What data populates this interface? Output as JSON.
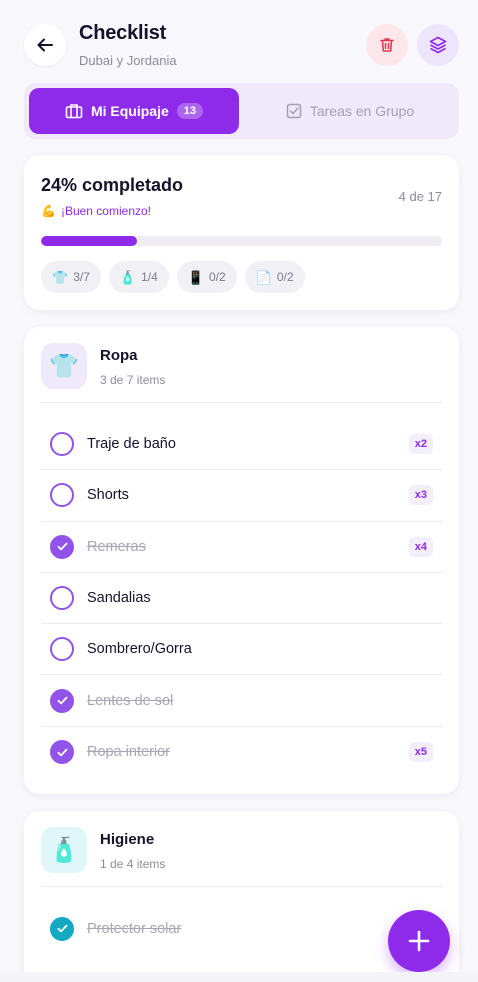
{
  "header": {
    "title": "Checklist",
    "subtitle": "Dubai y Jordania",
    "icons": {
      "back": "arrow-left-icon",
      "delete": "trash-icon",
      "layers": "layers-icon"
    },
    "colors": {
      "delete_bg": "#fde7eb",
      "delete_fg": "#e03a52",
      "layers_bg": "#ede5fc",
      "layers_fg": "#8e2bea"
    }
  },
  "tabs": [
    {
      "label": "Mi Equipaje",
      "badge": "13",
      "active": true,
      "icon": "luggage-icon"
    },
    {
      "label": "Tareas en Grupo",
      "active": false,
      "icon": "checkbox-icon"
    }
  ],
  "progress": {
    "title": "24% completado",
    "count": "4 de 17",
    "message_emoji": "💪",
    "message": "¡Buen comienzo!",
    "percent": 24,
    "chips": [
      {
        "emoji": "👕",
        "label": "3/7"
      },
      {
        "emoji": "🧴",
        "label": "1/4"
      },
      {
        "emoji": "📱",
        "label": "0/2"
      },
      {
        "emoji": "📄",
        "label": "0/2"
      }
    ]
  },
  "categories": [
    {
      "name": "Ropa",
      "emoji": "👕",
      "summary": "3 de 7 items",
      "items": [
        {
          "label": "Traje de baño",
          "qty": "x2",
          "done": false
        },
        {
          "label": "Shorts",
          "qty": "x3",
          "done": false
        },
        {
          "label": "Remeras",
          "qty": "x4",
          "done": true
        },
        {
          "label": "Sandalias",
          "qty": "",
          "done": false
        },
        {
          "label": "Sombrero/Gorra",
          "qty": "",
          "done": false
        },
        {
          "label": "Lentes de sol",
          "qty": "",
          "done": true
        },
        {
          "label": "Ropa interior",
          "qty": "x5",
          "done": true
        }
      ]
    },
    {
      "name": "Higiene",
      "emoji": "🧴",
      "summary": "1 de 4 items",
      "items": [
        {
          "label": "Protector solar",
          "qty": "",
          "done": true
        }
      ]
    }
  ],
  "fab": {
    "icon": "plus-icon"
  },
  "colors": {
    "accent": "#8e2bea",
    "teal": "#13a9c3"
  }
}
